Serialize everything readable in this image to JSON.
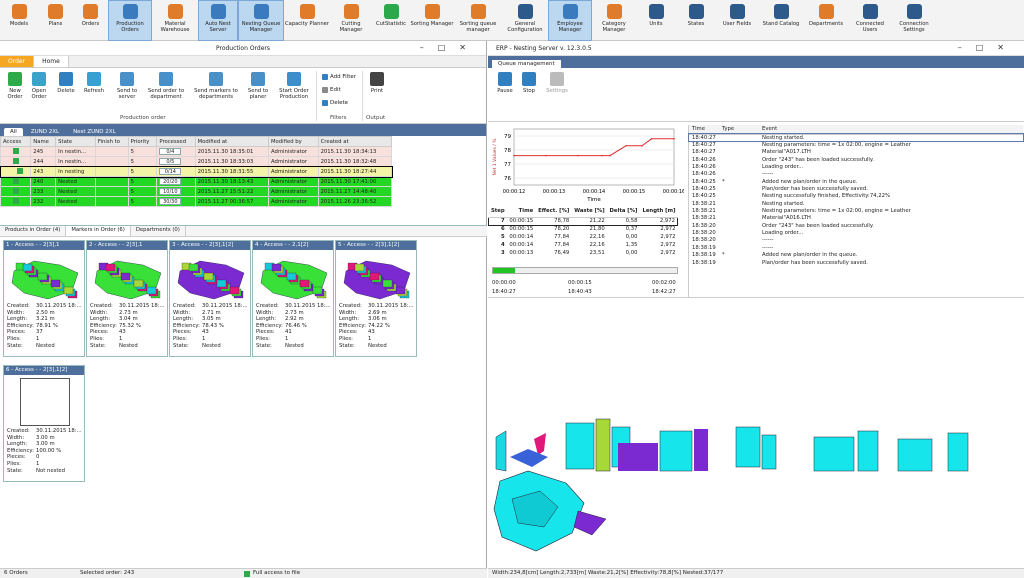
{
  "toolbar": [
    {
      "label": "Models",
      "icon": "models-icon",
      "color": "#e07b2a"
    },
    {
      "label": "Plans",
      "icon": "plans-icon",
      "color": "#e07b2a"
    },
    {
      "label": "Orders",
      "icon": "orders-icon",
      "color": "#e07b2a"
    },
    {
      "label": "Production Orders",
      "icon": "production-orders-icon",
      "color": "#3a7bbf",
      "selected": true
    },
    {
      "label": "Material Warehouse",
      "icon": "material-warehouse-icon",
      "color": "#e07b2a"
    },
    {
      "label": "Auto Nest Server",
      "icon": "auto-nest-icon",
      "color": "#3a7bbf",
      "selected": true
    },
    {
      "label": "Nesting Queue Manager",
      "icon": "nesting-queue-icon",
      "color": "#3a7bbf",
      "selected": true
    },
    {
      "label": "Capacity Planner",
      "icon": "capacity-icon",
      "color": "#e07b2a"
    },
    {
      "label": "Cutting Manager",
      "icon": "cutting-icon",
      "color": "#e07b2a"
    },
    {
      "label": "CutStatistic",
      "icon": "cutstatistic-icon",
      "color": "#2aa84a"
    },
    {
      "label": "Sorting Manager",
      "icon": "sorting-icon",
      "color": "#e07b2a"
    },
    {
      "label": "Sorting queue manager",
      "icon": "sorting-queue-icon",
      "color": "#e07b2a"
    },
    {
      "label": "General Configuration",
      "icon": "configuration-icon",
      "color": "#2d5a8a"
    },
    {
      "label": "Employee Manager",
      "icon": "employee-icon",
      "color": "#3a7bbf",
      "selected": true
    },
    {
      "label": "Category Manager",
      "icon": "category-icon",
      "color": "#e07b2a"
    },
    {
      "label": "Units",
      "icon": "units-icon",
      "color": "#2d5a8a"
    },
    {
      "label": "States",
      "icon": "states-icon",
      "color": "#2d5a8a"
    },
    {
      "label": "User Fields",
      "icon": "user-fields-icon",
      "color": "#2d5a8a"
    },
    {
      "label": "Stand Catalog",
      "icon": "stand-catalog-icon",
      "color": "#2d5a8a"
    },
    {
      "label": "Departments",
      "icon": "departments-icon",
      "color": "#e07b2a"
    },
    {
      "label": "Connected Users",
      "icon": "connected-users-icon",
      "color": "#2d5a8a"
    },
    {
      "label": "Connection Settings",
      "icon": "connection-settings-icon",
      "color": "#2d5a8a"
    }
  ],
  "left": {
    "title": "Production Orders",
    "ribbon_tabs": [
      "Order",
      "Home"
    ],
    "buttons": {
      "new": "New Order",
      "open": "Open Order",
      "delete": "Delete",
      "refresh": "Refresh",
      "send_server": "Send to server",
      "send_dept": "Send order to department",
      "send_markers": "Send markers to departments",
      "send_planer": "Send to planer",
      "start": "Start Order Production",
      "print": "Print"
    },
    "small": {
      "add_filter": "Add Filter",
      "edit": "Edit",
      "delete": "Delete"
    },
    "groups": {
      "production": "Production order",
      "filters": "Filters",
      "output": "Output"
    },
    "filter_tabs": [
      "All",
      "ZUND 2XL",
      "Nest ZUND 2XL"
    ],
    "columns": [
      "Access",
      "Name",
      "State",
      "Finish to",
      "Priority",
      "Processed",
      "Modified at",
      "Modified by",
      "Created at"
    ],
    "rows": [
      {
        "name": "245",
        "state": "In nestin...",
        "priority": "5",
        "processed": "0/4",
        "modified": "2015.11.30 18:35:01",
        "by": "Administrator",
        "created": "2015.11.30 18:34:13",
        "bg": "#f8e1dc"
      },
      {
        "name": "244",
        "state": "In nestin...",
        "priority": "5",
        "processed": "0/5",
        "modified": "2015.11.30 18:33:03",
        "by": "Administrator",
        "created": "2015.11.30 18:32:48",
        "bg": "#f8e1dc"
      },
      {
        "name": "243",
        "state": "In nesting",
        "priority": "5",
        "processed": "0/14",
        "modified": "2015.11.30 18:31:55",
        "by": "Administrator",
        "created": "2015.11.30 18:27:44",
        "bg": "#f4f4a8",
        "current": true
      },
      {
        "name": "240",
        "state": "Nested",
        "priority": "5",
        "processed": "20/20",
        "modified": "2015.11.30 18:13:43",
        "by": "Administrator",
        "created": "2015.11.30 17:41:00",
        "bg": "#22d822"
      },
      {
        "name": "233",
        "state": "Nested",
        "priority": "5",
        "processed": "10/10",
        "modified": "2015.11.27 15:51:22",
        "by": "Administrator",
        "created": "2015.11.27 14:48:40",
        "bg": "#22d822"
      },
      {
        "name": "232",
        "state": "Nested",
        "priority": "5",
        "processed": "30/30",
        "modified": "2015.11.27 00:36:57",
        "by": "Administrator",
        "created": "2015.11.26 23:36:52",
        "bg": "#22d822"
      }
    ],
    "sub_tabs": [
      "Products in Order (4)",
      "Markers in Order (6)",
      "Departments (0)"
    ],
    "labels": {
      "created": "Created:",
      "width": "Width:",
      "length": "Length:",
      "efficiency": "Efficiency:",
      "pieces": "Pieces:",
      "plies": "Plies:",
      "state": "State:"
    },
    "cards": [
      {
        "title": "1 - Access - - 2[3],1",
        "created": "30.11.2015 18:...",
        "width": "2.50 m",
        "length": "3.21 m",
        "efficiency": "78.91 %",
        "pieces": "37",
        "plies": "1",
        "state": "Nested",
        "img": true
      },
      {
        "title": "2 - Access - - 2[3],1",
        "created": "30.11.2015 18:...",
        "width": "2.73 m",
        "length": "3.04 m",
        "efficiency": "75.32 %",
        "pieces": "43",
        "plies": "1",
        "state": "Nested",
        "img": true
      },
      {
        "title": "3 - Access - - 2[3],1[2]",
        "created": "30.11.2015 18:...",
        "width": "2.71 m",
        "length": "3.05 m",
        "efficiency": "78.43 %",
        "pieces": "43",
        "plies": "1",
        "state": "Nested",
        "img": true
      },
      {
        "title": "4 - Access - - 2,1[2]",
        "created": "30.11.2015 18:...",
        "width": "2.73 m",
        "length": "2.92 m",
        "efficiency": "76.46 %",
        "pieces": "41",
        "plies": "1",
        "state": "Nested",
        "img": true
      },
      {
        "title": "5 - Access - - 2[3],1[2]",
        "created": "30.11.2015 18:...",
        "width": "2.69 m",
        "length": "3.06 m",
        "efficiency": "74.22 %",
        "pieces": "43",
        "plies": "1",
        "state": "Nested",
        "img": true
      },
      {
        "title": "6 - Access - - 2[3],1[2]",
        "created": "30.11.2015 18:...",
        "width": "3.00 m",
        "length": "3.00 m",
        "efficiency": "100.00 %",
        "pieces": "0",
        "plies": "1",
        "state": "Not nested",
        "img": false
      }
    ],
    "status": {
      "orders": "6 Orders",
      "selected": "Selected order: 243",
      "access": "Full access to file"
    }
  },
  "right": {
    "title": "ERP - Nesting Server v. 12.3.0.5",
    "queue_tab": "Queue management",
    "buttons": {
      "pause": "Pause",
      "stop": "Stop",
      "settings": "Settings"
    },
    "chart_data": {
      "type": "line",
      "ylabel": "Net 1 Values / %",
      "xlabel": "Time",
      "x": [
        "00:00:12",
        "00:00:13",
        "00:00:14",
        "00:00:15",
        "00:00:16"
      ],
      "yticks": [
        "79",
        "78",
        "77",
        "76"
      ],
      "ylim": [
        75.5,
        79.5
      ],
      "series": [
        {
          "values": [
            77.6,
            77.6,
            77.6,
            77.6,
            77.6,
            78.3,
            78.3,
            78.8,
            78.8
          ]
        }
      ],
      "color": "#e03030"
    },
    "steps_cols": [
      "Step",
      "Time",
      "Effect. [%]",
      "Waste [%]",
      "Delta [%]",
      "Length [m]"
    ],
    "steps": [
      [
        "7",
        "00:00:15",
        "78,78",
        "21,22",
        "0,58",
        "2,972"
      ],
      [
        "6",
        "00:00:15",
        "78,20",
        "21,80",
        "0,37",
        "2,972"
      ],
      [
        "5",
        "00:00:14",
        "77,84",
        "22,16",
        "0,00",
        "2,972"
      ],
      [
        "4",
        "00:00:14",
        "77,84",
        "22,16",
        "1,35",
        "2,972"
      ],
      [
        "3",
        "00:00:13",
        "76,49",
        "23,51",
        "0,00",
        "2,972"
      ]
    ],
    "timing": {
      "t1": "00:00:00",
      "t2": "00:00:15",
      "t3": "00:02:00",
      "s1": "18:40:27",
      "s2": "18:40:43",
      "s3": "18:42:27"
    },
    "ev_cols": [
      "Time",
      "Type",
      "Event"
    ],
    "events": [
      [
        "18:40:27",
        "",
        "Nesting started."
      ],
      [
        "18:40:27",
        "",
        "Nesting parameters: time = 1x 02:00, engine = Leather"
      ],
      [
        "18:40:27",
        "",
        "Material\"A017.LTH"
      ],
      [
        "18:40:26",
        "",
        "Order \"243\" has been loaded successfully."
      ],
      [
        "18:40:26",
        "",
        "Loading order..."
      ],
      [
        "18:40:26",
        "",
        "------"
      ],
      [
        "18:40:25",
        "*",
        "Added new plan/order in the queue."
      ],
      [
        "18:40:25",
        "",
        "Plan/order has been successfully saved."
      ],
      [
        "18:40:25",
        "",
        "Nesting successfully finished, Effectivity:74,22%"
      ],
      [
        "18:38:21",
        "",
        "Nesting started."
      ],
      [
        "18:38:21",
        "",
        "Nesting parameters: time = 1x 02:00, engine = Leather"
      ],
      [
        "18:38:21",
        "",
        "Material\"A016.LTH"
      ],
      [
        "18:38:20",
        "",
        "Order \"243\" has been loaded successfully."
      ],
      [
        "18:38:20",
        "",
        "Loading order..."
      ],
      [
        "18:38:20",
        "",
        "------"
      ],
      [
        "18:38:19",
        "",
        "------"
      ],
      [
        "18:38:19",
        "*",
        "Added new plan/order in the queue."
      ],
      [
        "18:38:19",
        "",
        "Plan/order has been successfully saved."
      ]
    ],
    "status": "Width:234,8[cm]  Length:2,733[m]  Waste:21,2[%]  Effectivity:78,8[%]  Nested:37/177"
  }
}
